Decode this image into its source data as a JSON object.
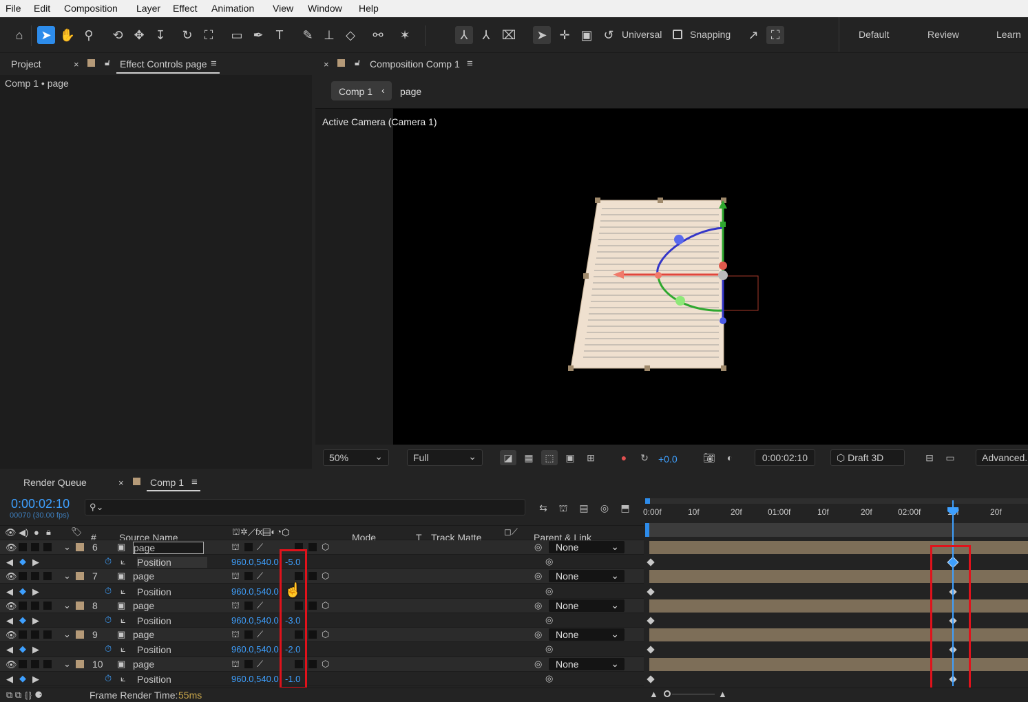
{
  "menu": [
    "File",
    "Edit",
    "Composition",
    "Layer",
    "Effect",
    "Animation",
    "View",
    "Window",
    "Help"
  ],
  "toolbar": {
    "universal_label": "Universal",
    "snapping_label": "Snapping",
    "workspaces": [
      "Default",
      "Review",
      "Learn"
    ]
  },
  "left_panel": {
    "tab_project": "Project",
    "tab_effect_controls": "Effect Controls page",
    "breadcrumb": "Comp 1 • page"
  },
  "composition_panel": {
    "tab_label": "Composition Comp 1",
    "crumb_comp": "Comp 1",
    "crumb_layer": "page",
    "camera_label": "Active Camera (Camera 1)",
    "zoom": "50%",
    "resolution": "Full",
    "exposure": "+0.0",
    "timecode": "0:00:02:10",
    "renderer": "Draft 3D",
    "advanced": "Advanced..."
  },
  "timeline": {
    "tab_render_queue": "Render Queue",
    "tab_comp": "Comp 1",
    "current_time": "0:00:02:10",
    "frame_info": "00070 (30.00 fps)",
    "ruler_labels": [
      "0:00f",
      "10f",
      "20f",
      "01:00f",
      "10f",
      "20f",
      "02:00f",
      "10f",
      "20f"
    ],
    "columns": {
      "hash": "#",
      "source_name": "Source Name",
      "mode": "Mode",
      "t": "T",
      "track_matte": "Track Matte",
      "parent_link": "Parent & Link"
    },
    "layers": [
      {
        "num": "6",
        "name": "page",
        "parent": "None",
        "prop": "Position",
        "pos_xy": "960.0,540.0",
        "pos_z": "-5.0"
      },
      {
        "num": "7",
        "name": "page",
        "parent": "None",
        "prop": "Position",
        "pos_xy": "960.0,540.0",
        "pos_z": ""
      },
      {
        "num": "8",
        "name": "page",
        "parent": "None",
        "prop": "Position",
        "pos_xy": "960.0,540.0",
        "pos_z": "-3.0"
      },
      {
        "num": "9",
        "name": "page",
        "parent": "None",
        "prop": "Position",
        "pos_xy": "960.0,540.0",
        "pos_z": "-2.0"
      },
      {
        "num": "10",
        "name": "page",
        "parent": "None",
        "prop": "Position",
        "pos_xy": "960.0,540.0",
        "pos_z": "-1.0"
      }
    ],
    "footer_label": "Frame Render Time:",
    "footer_value": "55ms"
  },
  "colors": {
    "accent": "#2d8ceb",
    "value_blue": "#3ea0ff",
    "highlight_red": "#e0121b",
    "layer_label": "#b59a78"
  }
}
